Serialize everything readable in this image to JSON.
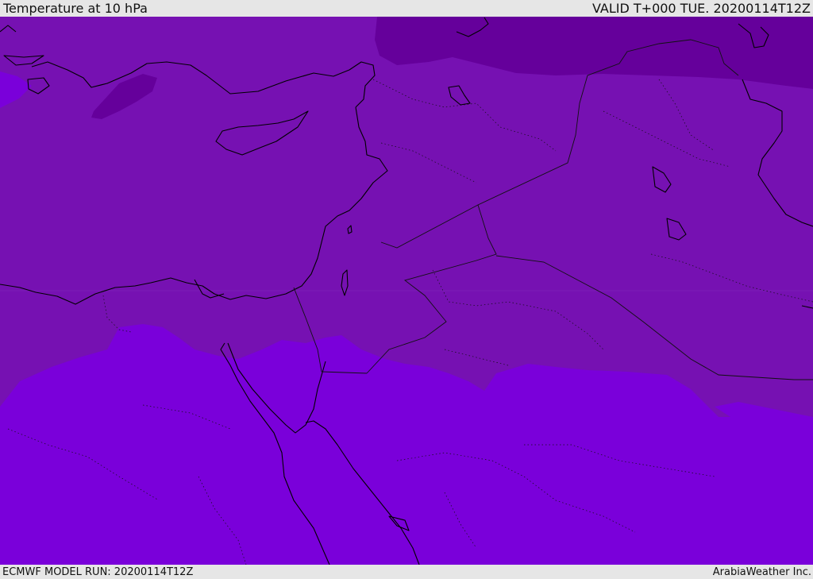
{
  "header": {
    "title": "Temperature at 10 hPa",
    "valid_time": "VALID T+000 TUE. 20200114T12Z"
  },
  "footer": {
    "model_run": "ECMWF MODEL RUN: 20200114T12Z",
    "credit": "ArabiaWeather Inc."
  },
  "map": {
    "colors": {
      "band_cold": "#65009b",
      "band_mid": "#7611b2",
      "band_warm": "#7a00da",
      "coastline": "#000000",
      "border": "#111111"
    }
  }
}
